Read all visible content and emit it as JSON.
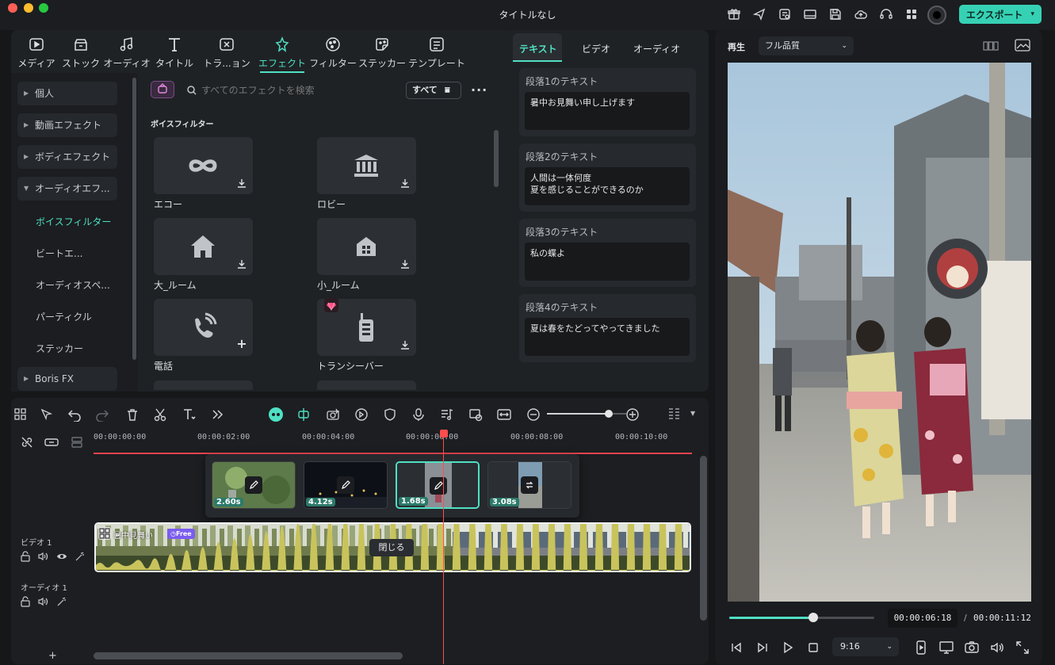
{
  "window": {
    "title": "タイトルなし"
  },
  "toolbar": {
    "export_label": "エクスポート"
  },
  "media_tabs": [
    {
      "label": "メディア",
      "icon": "media-icon"
    },
    {
      "label": "ストック",
      "icon": "stock-icon"
    },
    {
      "label": "オーディオ",
      "icon": "audio-icon"
    },
    {
      "label": "タイトル",
      "icon": "title-icon"
    },
    {
      "label": "トラ...ョン",
      "icon": "transition-icon"
    },
    {
      "label": "エフェクト",
      "icon": "effects-icon",
      "active": true
    },
    {
      "label": "フィルター",
      "icon": "filter-icon"
    },
    {
      "label": "ステッカー",
      "icon": "sticker-icon"
    },
    {
      "label": "テンプレート",
      "icon": "template-icon"
    }
  ],
  "categories": {
    "top": [
      "個人",
      "動画エフェクト",
      "ボディエフェクト",
      "オーディオエフ..."
    ],
    "sub": [
      "ボイスフィルター",
      "ビートエ...",
      "オーディオスペ...",
      "パーティクル",
      "ステッカー"
    ],
    "bottom": "Boris FX"
  },
  "effects": {
    "search_placeholder": "すべてのエフェクトを検索",
    "filter_label": "すべて",
    "section_title": "ボイスフィルター",
    "items": [
      {
        "label": "エコー",
        "icon": "infinity-icon"
      },
      {
        "label": "ロビー",
        "icon": "bank-icon"
      },
      {
        "label": "大_ルーム",
        "icon": "house-icon"
      },
      {
        "label": "小_ルーム",
        "icon": "small-house-icon"
      },
      {
        "label": "電話",
        "icon": "phone-icon"
      },
      {
        "label": "トランシーバー",
        "icon": "walkie-talkie-icon"
      }
    ]
  },
  "text_panel": {
    "tabs": [
      "テキスト",
      "ビデオ",
      "オーディオ"
    ],
    "paragraphs": [
      {
        "label": "段落1のテキスト",
        "text": "暑中お見舞い申し上げます"
      },
      {
        "label": "段落2のテキスト",
        "text": "人間は一体何度\n夏を感じることができるのか"
      },
      {
        "label": "段落3のテキスト",
        "text": "私の蝶よ"
      },
      {
        "label": "段落4のテキスト",
        "text": "夏は春をたどってやってきました"
      }
    ]
  },
  "preview": {
    "label": "再生",
    "quality": "フル品質",
    "current_time": "00:00:06:18",
    "separator": "/",
    "total_time": "00:00:11:12",
    "progress": 0.58,
    "aspect": "9:16"
  },
  "timeline": {
    "ruler": [
      "00:00:00:00",
      "00:00:02:00",
      "00:00:04:00",
      "00:00:06:00",
      "00:00:08:00",
      "00:00:10:00"
    ],
    "clips": [
      {
        "duration": "2.60s"
      },
      {
        "duration": "4.12s"
      },
      {
        "duration": "1.68s"
      },
      {
        "duration": "3.08s"
      }
    ],
    "close_label": "閉じる",
    "video_track": "ビデオ 1",
    "audio_track": "オーディオ 1",
    "clip_title": "暑中見舞い",
    "free_badge": "Free",
    "zoom": 0.78
  },
  "colors": {
    "accent": "#4fe0c3",
    "export": "#36d1b4",
    "playhead": "#ff4d4d"
  }
}
